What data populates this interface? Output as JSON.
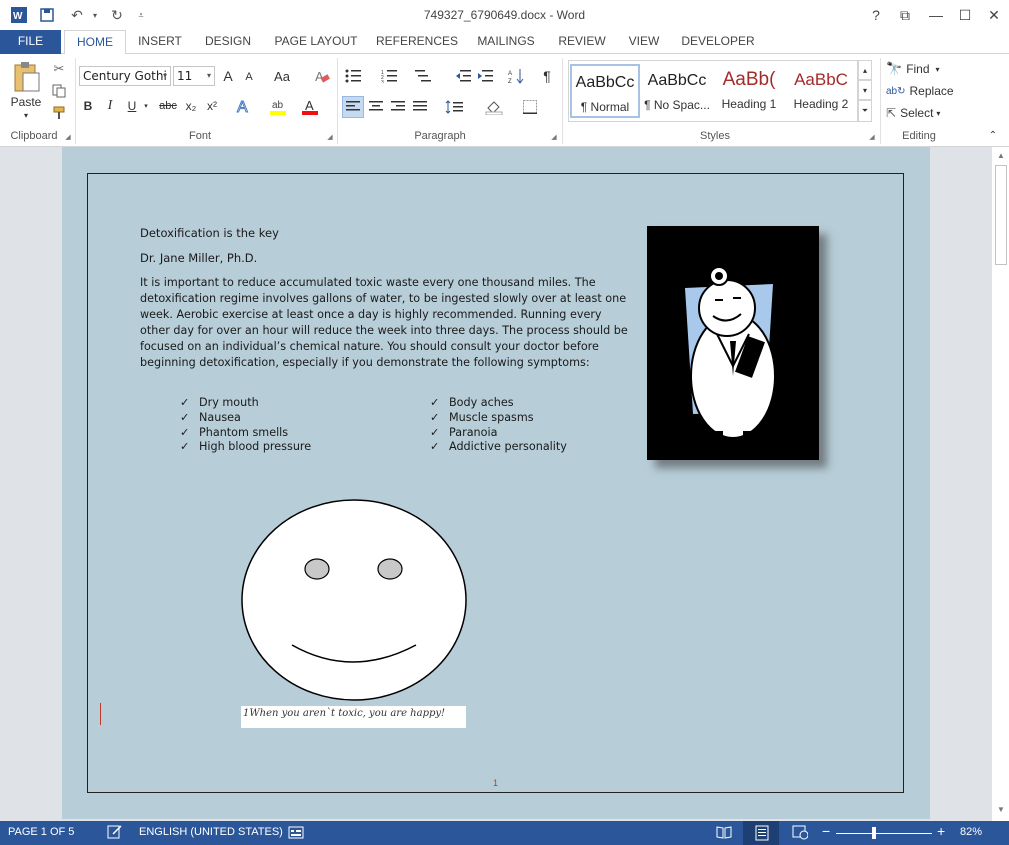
{
  "titlebar": {
    "title": "749327_6790649.docx - Word",
    "help": "?",
    "restore_ribbon": "⧉",
    "minimize": "—",
    "maximize": "☐",
    "close": "✕"
  },
  "tabs": [
    "FILE",
    "HOME",
    "INSERT",
    "DESIGN",
    "PAGE LAYOUT",
    "REFERENCES",
    "MAILINGS",
    "REVIEW",
    "VIEW",
    "DEVELOPER"
  ],
  "ribbon": {
    "clipboard": {
      "paste": "Paste",
      "label": "Clipboard"
    },
    "font": {
      "name": "Century Gothi",
      "size": "11",
      "label": "Font",
      "bold": "B",
      "italic": "I",
      "underline": "U",
      "strike": "abc",
      "sub": "x₂",
      "sup": "x²",
      "grow": "A",
      "shrink": "A",
      "case": "Aa"
    },
    "paragraph": {
      "label": "Paragraph"
    },
    "styles": {
      "label": "Styles",
      "items": [
        {
          "sample": "AaBbCc",
          "name": "¶ Normal"
        },
        {
          "sample": "AaBbCc",
          "name": "¶ No Spac..."
        },
        {
          "sample": "AaBb(",
          "name": "Heading 1"
        },
        {
          "sample": "AaBbC",
          "name": "Heading 2"
        }
      ]
    },
    "editing": {
      "label": "Editing",
      "find": "Find",
      "replace": "Replace",
      "select": "Select"
    }
  },
  "document": {
    "title_line": "Detoxification is the key",
    "author": "Dr. Jane Miller, Ph.D.",
    "body": "It is important to reduce accumulated toxic waste every one thousand miles. The detoxification regime involves gallons of water, to be ingested slowly over at least one week. Aerobic exercise at least once a day is highly recommended. Running every other day for over an hour will reduce the week into three days.  The process should be focused on an individual’s chemical nature. You should consult your doctor before beginning detoxification, especially if you demonstrate the following symptoms:",
    "check_glyph": "✓",
    "symptoms_left": [
      "Dry mouth",
      "Nausea",
      "Phantom smells",
      "High blood pressure"
    ],
    "symptoms_right": [
      "Body aches",
      "Muscle spasms",
      "Paranoia",
      "Addictive personality"
    ],
    "caption": "1When you aren`t toxic, you are happy!",
    "page_number": "1"
  },
  "statusbar": {
    "page": "PAGE 1 OF 5",
    "language": "ENGLISH (UNITED STATES)",
    "zoom": "82%",
    "zoom_minus": "−",
    "zoom_plus": "+"
  },
  "colors": {
    "accent": "#2b579a",
    "page_bg": "#b7cdd8"
  }
}
